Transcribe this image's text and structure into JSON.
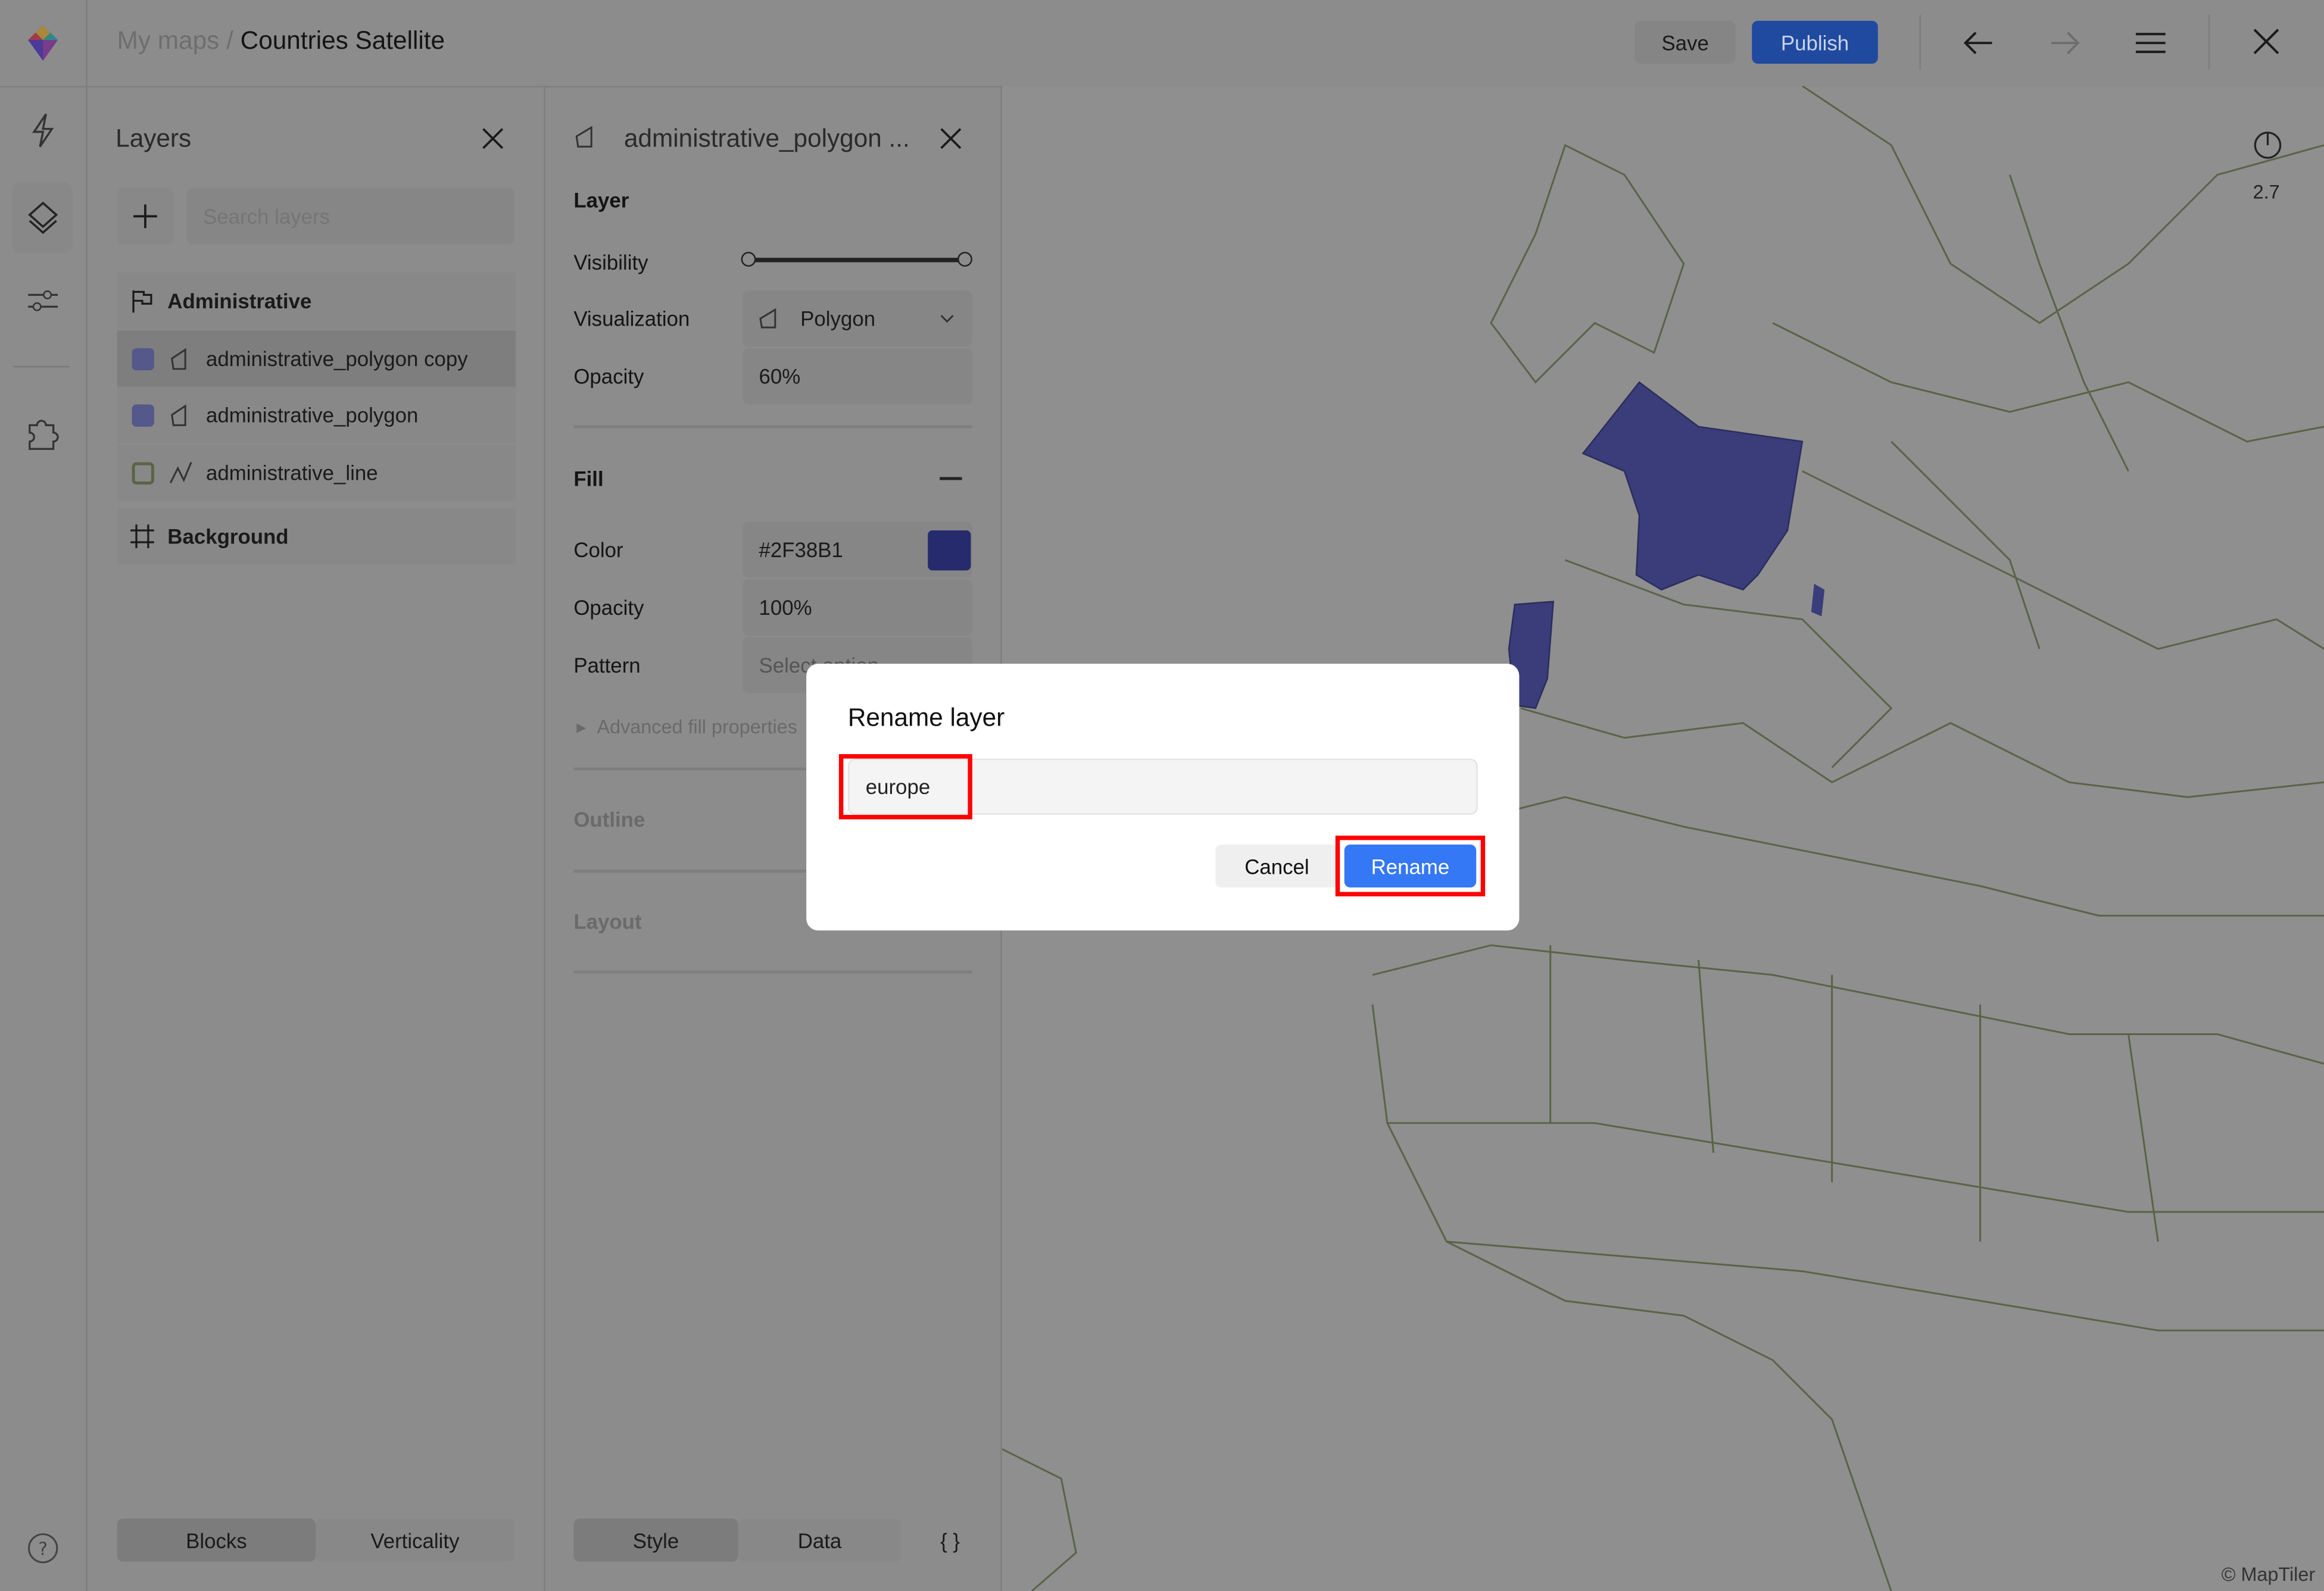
{
  "topbar": {
    "breadcrumb_root": "My maps",
    "breadcrumb_sep": "/",
    "title": "Countries Satellite",
    "save": "Save",
    "publish": "Publish"
  },
  "layers_panel": {
    "title": "Layers",
    "search_placeholder": "Search layers",
    "groups": [
      {
        "label": "Administrative"
      },
      {
        "label": "Background"
      }
    ],
    "items": [
      {
        "label": "administrative_polygon copy",
        "color": "#54588a"
      },
      {
        "label": "administrative_polygon",
        "color": "#54588a"
      },
      {
        "label": "administrative_line",
        "color": "#5a6347"
      }
    ],
    "tabs": [
      "Blocks",
      "Verticality"
    ]
  },
  "props_panel": {
    "title": "administrative_polygon ...",
    "section_layer": "Layer",
    "visibility_label": "Visibility",
    "visualization_label": "Visualization",
    "visualization_value": "Polygon",
    "opacity_label": "Opacity",
    "opacity_value": "60%",
    "section_fill": "Fill",
    "color_label": "Color",
    "color_value": "#2F38B1",
    "fill_opacity_label": "Opacity",
    "fill_opacity_value": "100%",
    "pattern_label": "Pattern",
    "pattern_value": "Select option",
    "advanced": "Advanced fill properties",
    "section_outline": "Outline",
    "section_layout": "Layout",
    "tabs": [
      "Style",
      "Data"
    ],
    "code": "{ }"
  },
  "map": {
    "zoom": "2.7",
    "attribution": "© MapTiler"
  },
  "dialog": {
    "title": "Rename layer",
    "input_value": "europe",
    "cancel": "Cancel",
    "confirm": "Rename"
  },
  "colors": {
    "accent": "#3478f6",
    "highlight": "#ff0000",
    "fill": "#2F38B1"
  }
}
